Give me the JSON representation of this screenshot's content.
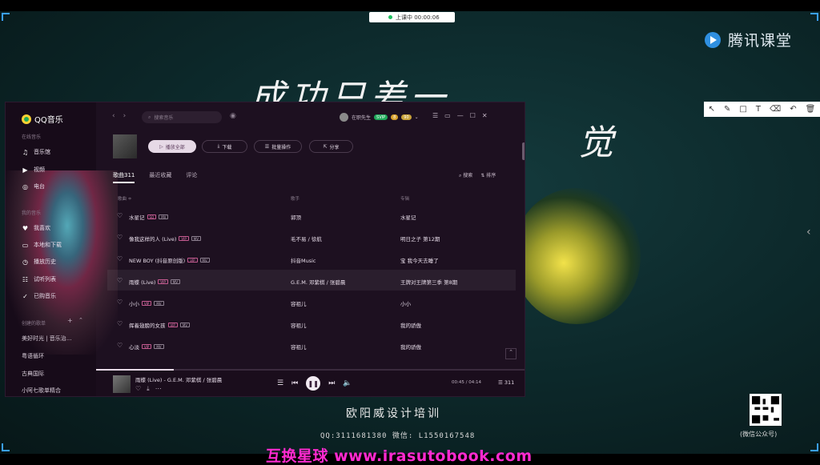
{
  "stage": {
    "rec_label": "上课中 00:00:06",
    "brand": "腾讯课堂",
    "slogan": "成功只差一",
    "slogan_tail": "觉",
    "annot_tools": [
      "↖",
      "✎",
      "□",
      "T",
      "⌫",
      "↶",
      "🗑"
    ],
    "caption_title": "欧阳威设计培训",
    "caption_contact": "QQ:3111681380    微信: L1550167548",
    "qr_label": "(微信公众号)",
    "watermark": "互换星球 www.irasutobook.com"
  },
  "app": {
    "name": "QQ音乐",
    "search_placeholder": "搜索音乐",
    "user_name": "在职先生",
    "badges": [
      "SVIP",
      "8",
      "90"
    ],
    "controls": [
      "☰",
      "▭",
      "—",
      "☐",
      "✕"
    ]
  },
  "sidebar": {
    "section_online": "在线音乐",
    "online_items": [
      {
        "icon": "music-note-icon",
        "glyph": "♫",
        "label": "音乐馆"
      },
      {
        "icon": "video-icon",
        "glyph": "▶",
        "label": "视频"
      },
      {
        "icon": "radio-icon",
        "glyph": "◎",
        "label": "电台"
      }
    ],
    "section_mine": "我的音乐",
    "mine_items": [
      {
        "icon": "heart-icon",
        "glyph": "♥",
        "label": "我喜欢"
      },
      {
        "icon": "computer-icon",
        "glyph": "▭",
        "label": "本地和下载"
      },
      {
        "icon": "history-icon",
        "glyph": "◷",
        "label": "播放历史"
      },
      {
        "icon": "trial-list-icon",
        "glyph": "☷",
        "label": "试听列表"
      },
      {
        "icon": "purchased-icon",
        "glyph": "✓",
        "label": "已购音乐"
      }
    ],
    "section_created": "创建的歌单",
    "created_playlists": [
      "美好时光 | 音乐治...",
      "粤语循环",
      "古典国际",
      "小阿七歌单精合"
    ]
  },
  "actions": {
    "play_all": "播放全部",
    "download": "下载",
    "batch": "批量操作",
    "share": "分享"
  },
  "tabs": [
    {
      "label": "歌曲311",
      "active": true
    },
    {
      "label": "最近收藏",
      "active": false
    },
    {
      "label": "评论",
      "active": false
    }
  ],
  "tools_right": {
    "search": "搜索",
    "sort": "排序"
  },
  "columns": {
    "title": "歌曲 ≑",
    "artist": "歌手",
    "album": "专辑"
  },
  "songs": [
    {
      "title": "水星记",
      "tags": [
        "SQ",
        "MV"
      ],
      "artist": "郭顶",
      "album": "水星记"
    },
    {
      "title": "像我这样的人 (Live)",
      "tags": [
        "VIP",
        "MV"
      ],
      "artist": "毛不易 / 徐航",
      "album": "明日之子 第12期"
    },
    {
      "title": "NEW BOY (抖音原创版)",
      "tags": [
        "VIP",
        "MV"
      ],
      "artist": "抖音Music",
      "album": "宝 我今天去睡了"
    },
    {
      "title": "雨蝶 (Live)",
      "tags": [
        "VIP",
        "MV"
      ],
      "artist": "G.E.M. 邓紫棋 / 张碧晨",
      "album": "王牌对王牌第三季 第8期"
    },
    {
      "title": "小小",
      "tags": [
        "VIP",
        "MV"
      ],
      "artist": "容祖儿",
      "album": "小小"
    },
    {
      "title": "挥着翅膀的女孩",
      "tags": [
        "VIP",
        "MV"
      ],
      "artist": "容祖儿",
      "album": "我的骄傲"
    },
    {
      "title": "心淡",
      "tags": [
        "VIP",
        "MV"
      ],
      "artist": "容祖儿",
      "album": "我的骄傲"
    }
  ],
  "player": {
    "now_playing": "雨蝶 (Live) - G.E.M. 邓紫棋 / 张碧晨",
    "time": "00:45 / 04:14",
    "queue_count": "311",
    "progress": 0.18
  }
}
